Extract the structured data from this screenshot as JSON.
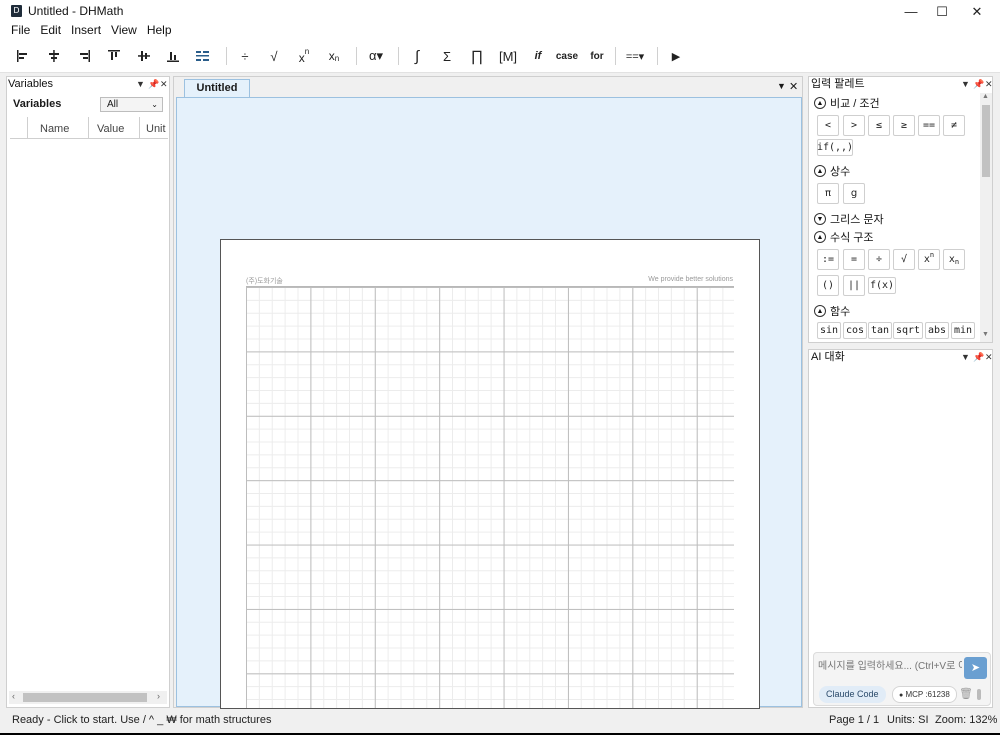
{
  "window": {
    "title": "Untitled - DHMath",
    "app_icon": "D",
    "minimize": "—",
    "maximize": "☐",
    "close": "✕"
  },
  "menu": [
    "File",
    "Edit",
    "Insert",
    "View",
    "Help"
  ],
  "toolbar": {
    "divide": "÷",
    "sqrt": "√",
    "power_base": "x",
    "power_exp": "n",
    "sub_base": "x",
    "sub_idx": "n",
    "greek": "α▾",
    "integral": "∫",
    "sum": "Σ",
    "product": "∏",
    "matrix": "[M]",
    "if": "if",
    "case": "case",
    "for": "for",
    "compare": "==▾",
    "run": "▶"
  },
  "variables": {
    "panel_title": "Variables",
    "label": "Variables",
    "filter_value": "All",
    "columns": [
      "Name",
      "Value",
      "Unit"
    ]
  },
  "document": {
    "tab_label": "Untitled",
    "header_left": "(주)도화기술",
    "header_right": "We provide better solutions"
  },
  "palette": {
    "panel_title": "입력 팔레트",
    "sections": {
      "compare": "비교 / 조건",
      "constants": "상수",
      "greek": "그리스 문자",
      "structure": "수식 구조",
      "functions": "함수"
    },
    "compare_items": [
      "<",
      ">",
      "≤",
      "≥",
      "==",
      "≠"
    ],
    "if_item": "if(,,)",
    "constant_items": [
      "π",
      "g"
    ],
    "structure_row1": [
      ":=",
      "=",
      "÷",
      "√"
    ],
    "power_base": "x",
    "power_exp": "n",
    "sub_base": "x",
    "sub_idx": "n",
    "structure_row2": [
      "()",
      "||",
      "f(x)"
    ],
    "function_items": [
      "sin",
      "cos",
      "tan",
      "sqrt",
      "abs",
      "min"
    ]
  },
  "ai": {
    "panel_title": "AI 대화",
    "input_placeholder": "메시지를 입력하세요... (Ctrl+V로 이",
    "model_label": "Claude Code",
    "mcp_label": "MCP :61238",
    "send_icon": "➤"
  },
  "status": {
    "message": "Ready - Click to start. Use / ^ _ ₩ for math structures",
    "page": "Page 1 / 1",
    "units": "Units: SI",
    "zoom": "Zoom: 132%"
  }
}
